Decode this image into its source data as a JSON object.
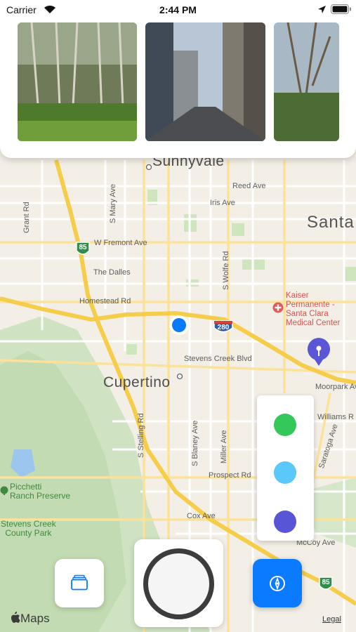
{
  "status_bar": {
    "carrier": "Carrier",
    "time": "2:44 PM"
  },
  "photos": [
    {
      "name": "forest-photo"
    },
    {
      "name": "city-street-photo"
    },
    {
      "name": "trees-photo"
    }
  ],
  "map": {
    "cities": {
      "sunnyvale": "Sunnyvale",
      "santa_clara": "Santa",
      "cupertino": "Cupertino"
    },
    "streets": {
      "reed_ave": "Reed Ave",
      "iris_ave": "Iris Ave",
      "grant_rd": "Grant Rd",
      "s_mary_ave": "S Mary Ave",
      "w_fremont_ave": "W Fremont Ave",
      "the_dalles": "The Dalles",
      "s_wolfe_rd": "S Wolfe Rd",
      "homestead_rd": "Homestead Rd",
      "stevens_creek_blvd": "Stevens Creek Blvd",
      "moorpark_ave": "Moorpark Ave",
      "williams_rd": "Williams R",
      "s_stelling_rd": "S Stelling Rd",
      "s_blaney_ave": "S Blaney Ave",
      "miller_ave": "Miller Ave",
      "saratoga_ave": "Saratoga Ave",
      "prospect_rd": "Prospect Rd",
      "cox_ave": "Cox Ave",
      "mccoy_ave": "McCoy Ave"
    },
    "pois": {
      "kaiser": [
        "Kaiser",
        "Permanente -",
        "Santa Clara",
        "Medical Center"
      ],
      "picchetti": [
        "Picchetti",
        "Ranch Preserve"
      ],
      "stevens_creek_park": [
        "Stevens Creek",
        "County Park"
      ]
    },
    "highway_shields": {
      "sr85_north": "85",
      "i280": "280",
      "sr85_south": "85"
    }
  },
  "color_picker": {
    "colors": [
      "#34c759",
      "#5ac8fa",
      "#5856d6"
    ]
  },
  "controls": {
    "maps_logo": "Maps",
    "legal": "Legal"
  },
  "colors": {
    "accent": "#0a7aff",
    "user_location": "#0a7aff",
    "pin": "#5a56d6",
    "highway": "#f5cd4a"
  },
  "icons": {
    "wifi": "wifi-icon",
    "location_arrow": "location-arrow-icon",
    "battery": "battery-icon",
    "layers": "layers-icon",
    "compass": "compass-icon",
    "apple": "apple-logo-icon"
  }
}
